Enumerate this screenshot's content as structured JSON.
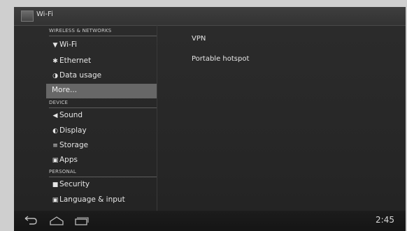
{
  "actionbar": {
    "title": "Wi-Fi",
    "icon": "settings-app-icon"
  },
  "sections": [
    {
      "header": "WIRELESS & NETWORKS",
      "items": [
        {
          "label": "Wi-Fi",
          "icon": "wifi-icon",
          "selected": false
        },
        {
          "label": "Ethernet",
          "icon": "ethernet-icon",
          "selected": false
        },
        {
          "label": "Data usage",
          "icon": "data-usage-icon",
          "selected": false
        },
        {
          "label": "More...",
          "icon": "",
          "selected": true
        }
      ]
    },
    {
      "header": "DEVICE",
      "items": [
        {
          "label": "Sound",
          "icon": "speaker-icon",
          "selected": false
        },
        {
          "label": "Display",
          "icon": "display-icon",
          "selected": false
        },
        {
          "label": "Storage",
          "icon": "storage-icon",
          "selected": false
        },
        {
          "label": "Apps",
          "icon": "apps-icon",
          "selected": false
        }
      ]
    },
    {
      "header": "PERSONAL",
      "items": [
        {
          "label": "Security",
          "icon": "lock-icon",
          "selected": false
        },
        {
          "label": "Language & input",
          "icon": "keyboard-icon",
          "selected": false
        }
      ]
    }
  ],
  "detail": {
    "items": [
      "VPN",
      "Portable hotspot"
    ]
  },
  "navbar": {
    "buttons": [
      "back-icon",
      "home-icon",
      "recents-icon"
    ],
    "clock": "2:45"
  },
  "colors": {
    "background": "#2a2a2a",
    "selected_item": "#676767",
    "text": "#e6e6e6"
  }
}
